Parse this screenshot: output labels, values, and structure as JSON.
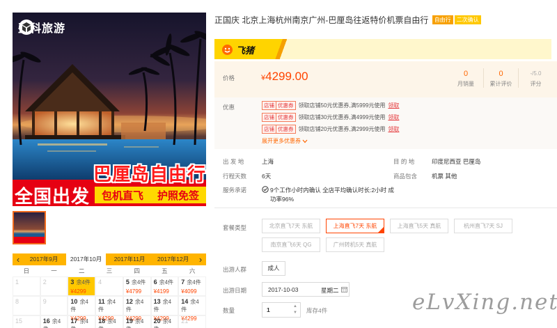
{
  "hero": {
    "logo_text": "盈科旅游",
    "banner_title": "巴厘岛自由行",
    "banner_left": "全国出发",
    "banner_feature_1": "包机直飞",
    "banner_feature_2": "护照免签"
  },
  "calendar": {
    "months": [
      "2017年9月",
      "2017年10月",
      "2017年11月",
      "2017年12月"
    ],
    "active": 1,
    "weekdays": [
      "日",
      "一",
      "二",
      "三",
      "四",
      "五",
      "六"
    ],
    "days": [
      {
        "day": "1"
      },
      {
        "day": "2"
      },
      {
        "day": "3",
        "stock": "余4件",
        "price": "¥4299",
        "selected": true
      },
      {
        "day": "4"
      },
      {
        "day": "5",
        "stock": "余4件",
        "price": "¥4799"
      },
      {
        "day": "6",
        "stock": "余4件",
        "price": "¥4199"
      },
      {
        "day": "7",
        "stock": "余4件",
        "price": "¥4099"
      },
      {
        "day": "8"
      },
      {
        "day": "9"
      },
      {
        "day": "10",
        "stock": "余4件",
        "price": "¥4299"
      },
      {
        "day": "11",
        "stock": "余4件",
        "price": "¥4299"
      },
      {
        "day": "12",
        "stock": "余4件",
        "price": "¥4299"
      },
      {
        "day": "13",
        "stock": "余4件",
        "price": "¥4299"
      },
      {
        "day": "14",
        "stock": "余4件",
        "price": "¥4299"
      },
      {
        "day": "15"
      },
      {
        "day": "16",
        "stock": "余4件"
      },
      {
        "day": "17",
        "stock": "余4件"
      },
      {
        "day": "18",
        "stock": "余4件"
      },
      {
        "day": "19",
        "stock": "余4件"
      },
      {
        "day": "20",
        "stock": "余4件"
      },
      {
        "day": "21"
      }
    ]
  },
  "product": {
    "title": "正国庆 北京上海杭州南京广州-巴厘岛往返特价机票自由行",
    "tags": [
      "自由行",
      "二次确认"
    ]
  },
  "brand": {
    "name": "飞猪"
  },
  "price": {
    "label": "价格",
    "currency": "¥",
    "amount": "4299.00",
    "stats": [
      {
        "value": "0",
        "label": "月销量"
      },
      {
        "value": "0",
        "label": "累计评价"
      },
      {
        "value": "-/5.0",
        "label": "评分"
      }
    ]
  },
  "coupons": {
    "label": "优惠",
    "items": [
      {
        "tag_a": "店铺",
        "tag_b": "优惠券",
        "text": "领取店铺50元优惠券,满5999元使用",
        "action": "领取"
      },
      {
        "tag_a": "店铺",
        "tag_b": "优惠券",
        "text": "领取店铺30元优惠券,满4999元使用",
        "action": "领取"
      },
      {
        "tag_a": "店铺",
        "tag_b": "优惠券",
        "text": "领取店铺20元优惠券,满2999元使用",
        "action": "领取"
      }
    ],
    "expand": "展开更多优惠券"
  },
  "details": {
    "departure_label": "出 发 地",
    "departure": "上海",
    "destination_label": "目 的 地",
    "destination": "印度尼西亚 巴厘岛",
    "duration_label": "行程天数",
    "duration": "6天",
    "includes_label": "商品包含",
    "includes": "机票 其他",
    "service_label": "服务承诺",
    "service": "9个工作小时内确认 全店平均确认时长:2小时 成功率96%"
  },
  "package": {
    "label": "套餐类型",
    "options": [
      "北京直飞7天 东航",
      "上海直飞7天 东航",
      "上海直飞5天 真航",
      "杭州直飞7天 SJ",
      "南京直飞6天 QG",
      "广州转机5天 真航"
    ],
    "selected": 1
  },
  "travelers": {
    "label": "出游人群",
    "value": "成人"
  },
  "travel_date": {
    "label": "出游日期",
    "value": "2017-10-03",
    "weekday": "星期二"
  },
  "quantity": {
    "label": "数量",
    "value": "1",
    "stock": "库存4件"
  },
  "watermark": "eLvXing.net",
  "colors": {
    "accent": "#ff4400",
    "calendar_highlight": "#ffc800",
    "brand_yellow": "#ffd400"
  }
}
